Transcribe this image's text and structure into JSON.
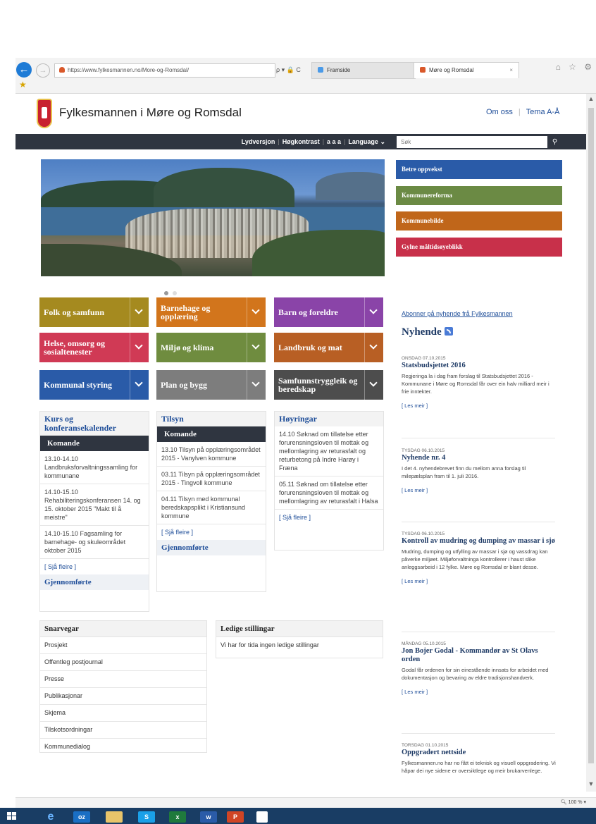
{
  "browser": {
    "url": "https://www.fylkesmannen.no/More-og-Romsdal/",
    "address_controls": "ρ ▾ 🔒 C",
    "tabs": [
      {
        "label": "Framside"
      },
      {
        "label": "Møre og Romsdal"
      }
    ],
    "tab_close": "×",
    "right_icons": "⌂ ☆ ⚙",
    "zoom": "100 %"
  },
  "site": {
    "title": "Fylkesmannen i Møre og Romsdal",
    "top_links": [
      {
        "label": "Om oss"
      },
      {
        "label": "Tema A-Å"
      }
    ],
    "toolbar": {
      "lydversjon": "Lydversjon",
      "hogkontrast": "Høgkontrast",
      "textsize": "a a a",
      "language": "Language"
    },
    "search_placeholder": "Søk"
  },
  "banners": [
    {
      "label": "Betre oppvekst",
      "color": "#2a5ba8"
    },
    {
      "label": "Kommunereforma",
      "color": "#6b8a44"
    },
    {
      "label": "Kommunebilde",
      "color": "#c0661a"
    },
    {
      "label": "Gylne måltidsøyeblikk",
      "color": "#c8304a"
    }
  ],
  "tiles": [
    {
      "label": "Folk og samfunn",
      "color": "#a58a1f"
    },
    {
      "label": "Barnehage og opplæring",
      "color": "#d2751c"
    },
    {
      "label": "Barn og foreldre",
      "color": "#8a44a8"
    },
    {
      "label": "Helse, omsorg og sosialtenester",
      "color": "#d03a55"
    },
    {
      "label": "Miljø og klima",
      "color": "#6f8c3f"
    },
    {
      "label": "Landbruk og mat",
      "color": "#b85f24"
    },
    {
      "label": "Kommunal styring",
      "color": "#2a5ba8"
    },
    {
      "label": "Plan og bygg",
      "color": "#7d7d7d"
    },
    {
      "label": "Samfunnstryggleik og beredskap",
      "color": "#4d4d4d"
    }
  ],
  "kurs": {
    "title": "Kurs og konferansekalender",
    "sub": "Komande",
    "items": [
      {
        "text": "13.10-14.10 Landbruksforvaltningssamling for kommunane"
      },
      {
        "text": "14.10-15.10 Rehabiliteringskonferansen 14. og 15. oktober 2015 \"Makt til å meistre\""
      },
      {
        "text": "14.10-15.10 Fagsamling for barnehage- og skuleområdet oktober 2015"
      }
    ],
    "more": "[ Sjå fleire ]",
    "foot": "Gjennomførte"
  },
  "tilsyn": {
    "title": "Tilsyn",
    "sub": "Komande",
    "items": [
      {
        "text": "13.10 Tilsyn på opplæringsområdet 2015 - Vanylven kommune"
      },
      {
        "text": "03.11 Tilsyn på opplæringsområdet 2015 - Tingvoll kommune"
      },
      {
        "text": "04.11 Tilsyn med kommunal beredskapsplikt i Kristiansund kommune"
      }
    ],
    "more": "[ Sjå fleire ]",
    "foot": "Gjennomførte"
  },
  "hoyringar": {
    "title": "Høyringar",
    "items": [
      {
        "text": "14.10 Søknad om tillatelse etter forurensningsloven til mottak og mellomlagring av returasfalt og returbetong på Indre Harøy i Fræna"
      },
      {
        "text": "05.11 Søknad om tillatelse etter forurensningsloven til mottak og mellomlagring av returasfalt i Halsa"
      }
    ],
    "more": "[ Sjå fleire ]"
  },
  "snarvegar": {
    "title": "Snarvegar",
    "items": [
      {
        "label": "Prosjekt"
      },
      {
        "label": "Offentleg postjournal"
      },
      {
        "label": "Presse"
      },
      {
        "label": "Publikasjonar"
      },
      {
        "label": "Skjema"
      },
      {
        "label": "Tilskotsordningar"
      },
      {
        "label": "Kommunedialog"
      }
    ]
  },
  "stillingar": {
    "title": "Ledige stillingar",
    "text": "Vi har for tida ingen ledige stillingar"
  },
  "news": {
    "subscribe": "Abonner på nyhende frå Fylkesmannen",
    "heading": "Nyhende",
    "items": [
      {
        "date": "ONSDAG 07.10.2015",
        "title": "Statsbudsjettet 2016",
        "body": "Regjeringa la i dag fram forslag til Statsbudsjettet 2016 - Kommunane i Møre og Romsdal får over ein halv milliard meir i frie inntekter.",
        "more": "[ Les meir ]"
      },
      {
        "date": "TYSDAG 06.10.2015",
        "title": "Nyhende nr. 4",
        "body": "I det 4. nyhendebrevet finn du mellom anna forslag til milepælsplan fram til 1. juli 2016.",
        "more": "[ Les meir ]"
      },
      {
        "date": "TYSDAG 06.10.2015",
        "title": "Kontroll av mudring og dumping av massar i sjø",
        "body": "Mudring, dumping og utfylling av massar i sjø og vassdrag kan påverke miljøet. Miljøforvaltninga kontrollerer i haust slike anleggsarbeid i 12 fylke. Møre og Romsdal er blant desse.",
        "more": "[ Les meir ]"
      },
      {
        "date": "MÅNDAG 05.10.2015",
        "title": "Jon Bojer Godal - Kommandør av St Olavs orden",
        "body": "Godal får ordenen for sin einestående innsats for arbeidet med dokumentasjon og bevaring av eldre tradisjonshandverk.",
        "more": "[ Les meir ]"
      },
      {
        "date": "TORSDAG 01.10.2015",
        "title": "Oppgradert nettside",
        "body": "Fylkesmannen.no har no fått ei teknisk og visuell oppgradering. Vi håpar dei nye sidene er oversiktlege og meir brukarvenlege.",
        "more": ""
      }
    ]
  }
}
